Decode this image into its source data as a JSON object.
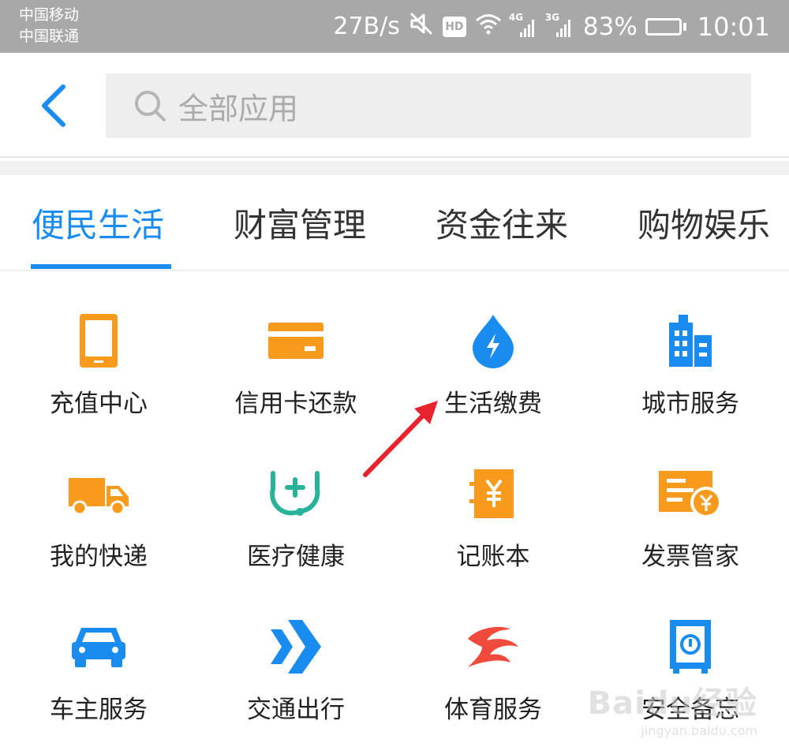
{
  "status_bar": {
    "carrier_1": "中国移动",
    "carrier_2": "中国联通",
    "net_speed": "27B/s",
    "hd_badge": "HD",
    "net_1_type": "4G",
    "net_2_type": "3G",
    "battery_percent": "83%",
    "battery_level": 0.83,
    "time": "10:01"
  },
  "header": {
    "search_placeholder": "全部应用"
  },
  "tabs": [
    {
      "label": "便民生活",
      "active": true
    },
    {
      "label": "财富管理",
      "active": false
    },
    {
      "label": "资金往来",
      "active": false
    },
    {
      "label": "购物娱乐",
      "active": false
    }
  ],
  "apps": [
    {
      "label": "充值中心",
      "icon": "phone-icon",
      "color": "#f89a1c"
    },
    {
      "label": "信用卡还款",
      "icon": "credit-card-icon",
      "color": "#f89a1c"
    },
    {
      "label": "生活缴费",
      "icon": "water-drop-bolt-icon",
      "color": "#1a8cf0"
    },
    {
      "label": "城市服务",
      "icon": "buildings-icon",
      "color": "#1a8cf0"
    },
    {
      "label": "我的快递",
      "icon": "truck-icon",
      "color": "#f89a1c"
    },
    {
      "label": "医疗健康",
      "icon": "stethoscope-icon",
      "color": "#26b39a"
    },
    {
      "label": "记账本",
      "icon": "ledger-yen-icon",
      "color": "#f89a1c"
    },
    {
      "label": "发票管家",
      "icon": "invoice-icon",
      "color": "#f89a1c"
    },
    {
      "label": "车主服务",
      "icon": "car-icon",
      "color": "#1a8cf0"
    },
    {
      "label": "交通出行",
      "icon": "double-chevron-icon",
      "color": "#1a8cf0"
    },
    {
      "label": "体育服务",
      "icon": "sports-swoosh-icon",
      "color": "#f04a3c"
    },
    {
      "label": "安全备忘",
      "icon": "safe-icon",
      "color": "#1a8cf0"
    }
  ],
  "watermark": {
    "brand": "Baidu经验",
    "url": "jingyan.baidu.com"
  },
  "colors": {
    "accent": "#1a8cf0",
    "orange": "#f89a1c",
    "status_bar_bg": "#a8a8a8",
    "arrow": "#e8232e"
  }
}
